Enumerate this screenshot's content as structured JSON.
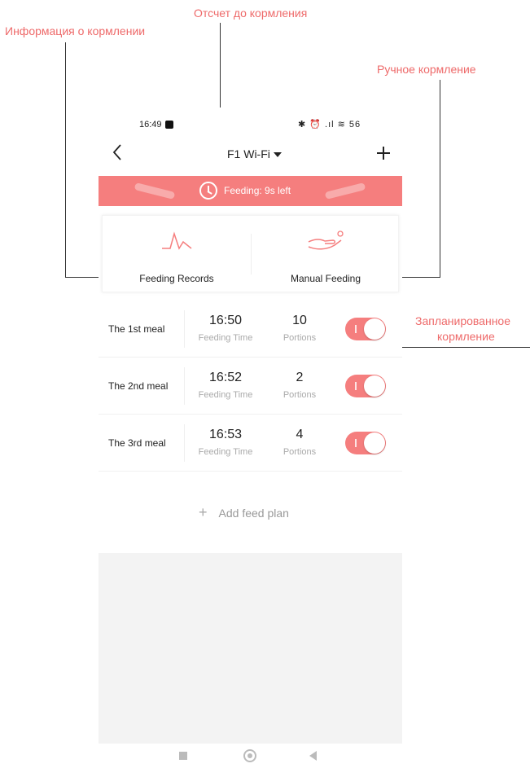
{
  "annotations": {
    "countdown": "Отсчет до кормления",
    "feeding_info": "Информация о кормлении",
    "manual_feeding": "Ручное кормление",
    "scheduled_line1": "Запланированное",
    "scheduled_line2": "кормление"
  },
  "statusbar": {
    "time": "16:49",
    "icons": "✱ ⏰ .ıl ≋ 56"
  },
  "header": {
    "title": "F1 Wi-Fi",
    "back_icon": "chevron-left-icon",
    "add_icon": "plus-icon"
  },
  "banner": {
    "text": "Feeding: 9s left",
    "color": "#f57e7e"
  },
  "cards": [
    {
      "label": "Feeding Records",
      "icon": "pulse-icon"
    },
    {
      "label": "Manual Feeding",
      "icon": "hand-feed-icon"
    }
  ],
  "meals": [
    {
      "name": "The 1st meal",
      "time": "16:50",
      "time_label": "Feeding Time",
      "portions": "10",
      "portions_label": "Portions",
      "enabled": true
    },
    {
      "name": "The 2nd meal",
      "time": "16:52",
      "time_label": "Feeding Time",
      "portions": "2",
      "portions_label": "Portions",
      "enabled": true
    },
    {
      "name": "The 3rd meal",
      "time": "16:53",
      "time_label": "Feeding Time",
      "portions": "4",
      "portions_label": "Portions",
      "enabled": true
    }
  ],
  "add_plan": {
    "label": "Add feed plan",
    "icon": "+"
  },
  "colors": {
    "accent": "#f57e7e",
    "annotation": "#ee6a6a"
  }
}
